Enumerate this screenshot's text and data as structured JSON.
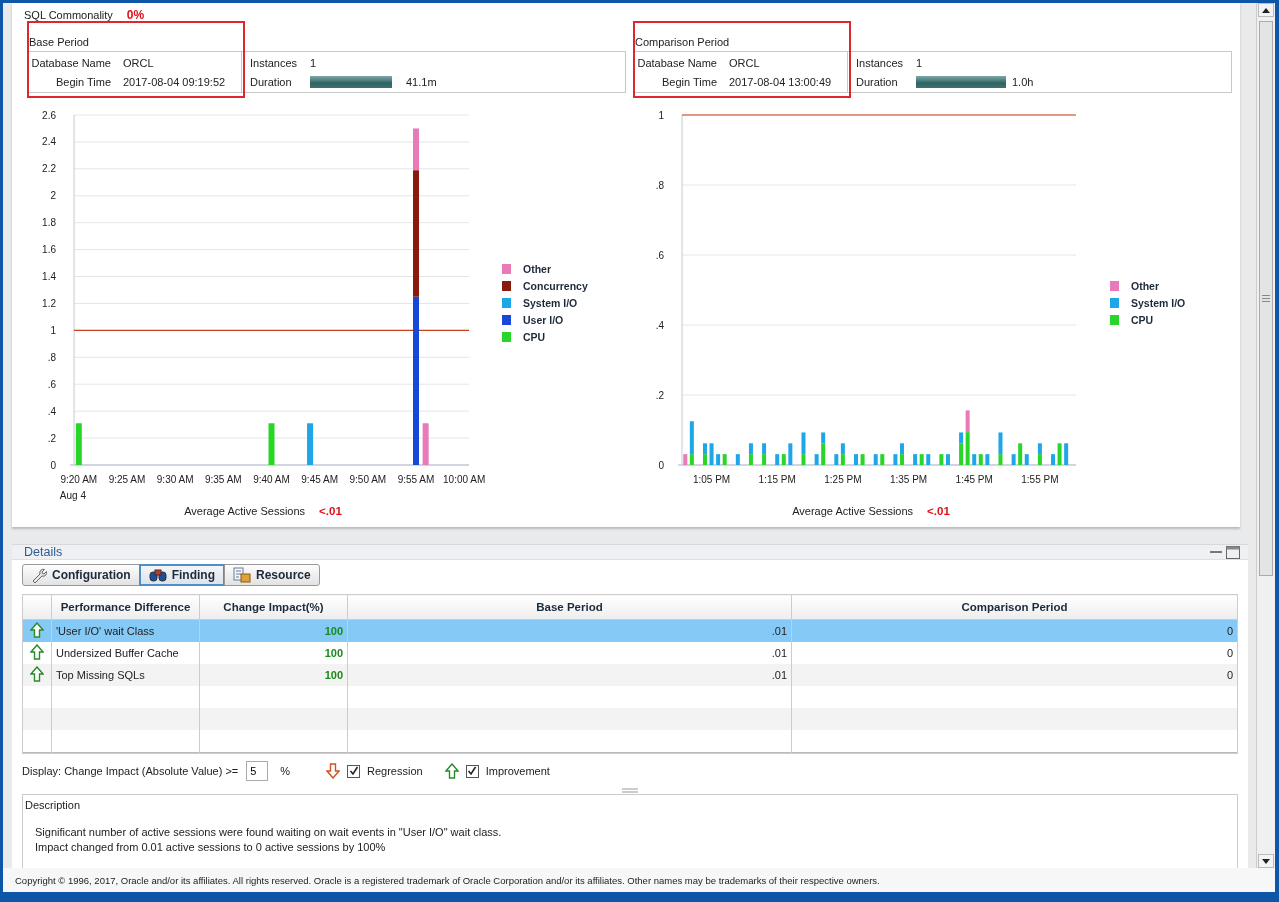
{
  "summary": {
    "label": "SQL Commonality",
    "value": "0%"
  },
  "periods": [
    {
      "title": "Base Period",
      "highlighted": true,
      "database_label": "Database Name",
      "database": "ORCL",
      "begin_label": "Begin Time",
      "begin": "2017-08-04 09:19:52",
      "instances_label": "Instances",
      "instances": "1",
      "duration_label": "Duration",
      "level": 0.91,
      "duration": "41.1m"
    },
    {
      "title": "Comparison Period",
      "highlighted": true,
      "database_label": "Database Name",
      "database": "ORCL",
      "begin_label": "Begin Time",
      "begin": "2017-08-04 13:00:49",
      "instances_label": "Instances",
      "instances": "1",
      "duration_label": "Duration",
      "level": 1.0,
      "duration": "1.0h"
    }
  ],
  "charts": [
    {
      "date_label": "Aug 4",
      "footer_label": "Average Active Sessions",
      "footer_value": "<.01",
      "chart_data": {
        "type": "bar",
        "stacked": true,
        "grid": true,
        "ylim": [
          0,
          2.6
        ],
        "categories": [
          "9:20 AM",
          null,
          null,
          null,
          null,
          "9:25 AM",
          null,
          null,
          null,
          null,
          "9:30 AM",
          null,
          null,
          null,
          null,
          "9:35 AM",
          null,
          null,
          null,
          null,
          "9:40 AM",
          null,
          null,
          null,
          null,
          "9:45 AM",
          null,
          null,
          null,
          null,
          "9:50 AM",
          null,
          null,
          null,
          null,
          "9:55 AM",
          null,
          null,
          null,
          null,
          "10:00 AM"
        ],
        "yticks": [
          0,
          {
            "value": 0.2,
            "label": ".2"
          },
          {
            "value": 0.4,
            "label": ".4"
          },
          {
            "value": 0.6,
            "label": ".6"
          },
          {
            "value": 0.8,
            "label": ".8"
          },
          1,
          1.2,
          1.4,
          1.6,
          1.8,
          2,
          2.2,
          2.4,
          2.6
        ],
        "ref_lines": [
          {
            "axis": "y",
            "value": 1,
            "color": "#c8401e"
          }
        ],
        "series": [
          {
            "name": "Other",
            "color": "#e87ab8",
            "values": [
              null,
              null,
              null,
              null,
              null,
              null,
              null,
              null,
              null,
              null,
              null,
              null,
              null,
              null,
              null,
              null,
              null,
              null,
              null,
              null,
              null,
              null,
              null,
              null,
              null,
              null,
              null,
              null,
              null,
              null,
              null,
              null,
              null,
              null,
              null,
              0.31,
              0.31,
              null,
              null,
              null,
              null
            ]
          },
          {
            "name": "Concurrency",
            "color": "#8b1a0e",
            "values": [
              null,
              null,
              null,
              null,
              null,
              null,
              null,
              null,
              null,
              null,
              null,
              null,
              null,
              null,
              null,
              null,
              null,
              null,
              null,
              null,
              null,
              null,
              null,
              null,
              null,
              null,
              null,
              null,
              null,
              null,
              null,
              null,
              null,
              null,
              null,
              0.94,
              null,
              null,
              null,
              null,
              null
            ]
          },
          {
            "name": "System I/O",
            "color": "#1ea7e8",
            "values": [
              null,
              null,
              null,
              null,
              null,
              null,
              null,
              null,
              null,
              null,
              null,
              null,
              null,
              null,
              null,
              null,
              null,
              null,
              null,
              null,
              null,
              null,
              null,
              null,
              0.31,
              null,
              null,
              null,
              null,
              null,
              null,
              null,
              null,
              null,
              null,
              null,
              null,
              null,
              null,
              null,
              null
            ]
          },
          {
            "name": "User I/O",
            "color": "#1848d8",
            "values": [
              null,
              null,
              null,
              null,
              null,
              null,
              null,
              null,
              null,
              null,
              null,
              null,
              null,
              null,
              null,
              null,
              null,
              null,
              null,
              null,
              null,
              null,
              null,
              null,
              null,
              null,
              null,
              null,
              null,
              null,
              null,
              null,
              null,
              null,
              null,
              1.25,
              null,
              null,
              null,
              null,
              null
            ]
          },
          {
            "name": "CPU",
            "color": "#28d628",
            "values": [
              0.31,
              null,
              null,
              null,
              null,
              null,
              null,
              null,
              null,
              null,
              null,
              null,
              null,
              null,
              null,
              null,
              null,
              null,
              null,
              null,
              0.31,
              null,
              null,
              null,
              null,
              null,
              null,
              null,
              null,
              null,
              null,
              null,
              null,
              null,
              null,
              null,
              null,
              null,
              null,
              null,
              null
            ]
          }
        ]
      }
    },
    {
      "footer_label": "Average Active Sessions",
      "footer_value": "<.01",
      "chart_data": {
        "type": "bar",
        "stacked": true,
        "grid": true,
        "ylim": [
          0,
          1
        ],
        "categories": [
          null,
          null,
          null,
          null,
          "1:05 PM",
          null,
          null,
          null,
          null,
          null,
          null,
          null,
          null,
          null,
          "1:15 PM",
          null,
          null,
          null,
          null,
          null,
          null,
          null,
          null,
          null,
          "1:25 PM",
          null,
          null,
          null,
          null,
          null,
          null,
          null,
          null,
          null,
          "1:35 PM",
          null,
          null,
          null,
          null,
          null,
          null,
          null,
          null,
          null,
          "1:45 PM",
          null,
          null,
          null,
          null,
          null,
          null,
          null,
          null,
          null,
          "1:55 PM",
          null,
          null,
          null,
          null,
          null
        ],
        "yticks": [
          0,
          {
            "value": 0.2,
            "label": ".2"
          },
          {
            "value": 0.4,
            "label": ".4"
          },
          {
            "value": 0.6,
            "label": ".6"
          },
          {
            "value": 0.8,
            "label": ".8"
          },
          1
        ],
        "ref_lines": [
          {
            "axis": "y",
            "value": 1,
            "color": "#c8401e"
          }
        ],
        "series": [
          {
            "name": "Other",
            "color": "#e87ab8",
            "values": [
              0.031,
              null,
              null,
              null,
              null,
              null,
              null,
              null,
              null,
              null,
              null,
              null,
              null,
              null,
              null,
              null,
              null,
              null,
              null,
              null,
              null,
              null,
              null,
              null,
              null,
              null,
              null,
              null,
              null,
              null,
              null,
              null,
              null,
              null,
              null,
              null,
              null,
              null,
              null,
              null,
              null,
              null,
              null,
              0.062,
              null,
              null,
              null,
              null,
              null,
              null,
              null,
              null,
              null,
              null,
              null,
              null,
              null,
              null,
              null,
              null
            ]
          },
          {
            "name": "System I/O",
            "color": "#1ea7e8",
            "values": [
              null,
              0.094,
              null,
              0.031,
              0.062,
              0.031,
              null,
              null,
              0.031,
              null,
              0.031,
              null,
              0.031,
              null,
              0.031,
              null,
              0.062,
              null,
              0.062,
              null,
              0.031,
              0.031,
              null,
              0.031,
              0.031,
              null,
              0.031,
              null,
              null,
              0.031,
              null,
              null,
              0.031,
              0.031,
              null,
              0.031,
              null,
              0.031,
              null,
              null,
              0.031,
              null,
              0.031,
              null,
              0.031,
              null,
              0.031,
              null,
              0.062,
              null,
              0.031,
              null,
              0.031,
              null,
              0.031,
              null,
              0.031,
              null,
              0.062,
              null
            ]
          },
          {
            "name": "CPU",
            "color": "#28d628",
            "values": [
              null,
              0.031,
              null,
              0.031,
              null,
              null,
              0.031,
              null,
              null,
              null,
              0.031,
              null,
              0.031,
              null,
              null,
              0.031,
              null,
              null,
              0.031,
              null,
              null,
              0.062,
              null,
              null,
              0.031,
              null,
              null,
              0.031,
              null,
              null,
              0.031,
              null,
              null,
              0.031,
              null,
              null,
              0.031,
              null,
              null,
              0.031,
              null,
              null,
              0.062,
              0.094,
              null,
              0.031,
              null,
              null,
              0.031,
              null,
              null,
              0.062,
              null,
              null,
              0.031,
              null,
              null,
              0.062,
              null,
              null
            ]
          }
        ]
      }
    }
  ],
  "details": {
    "title": "Details",
    "tabs": [
      {
        "label": "Configuration",
        "kind": "wrench",
        "selected": false
      },
      {
        "label": "Finding",
        "kind": "binoculars",
        "selected": true
      },
      {
        "label": "Resource",
        "kind": "resource",
        "selected": false
      }
    ],
    "table": {
      "columns": [
        "Performance Difference",
        "Change Impact(%)",
        "Base Period",
        "Comparison Period"
      ],
      "rows": [
        {
          "kind": "improvement",
          "selected": true,
          "finding": "'User I/O' wait Class",
          "impact": "100",
          "base": ".01",
          "comparison": "0"
        },
        {
          "kind": "improvement",
          "selected": false,
          "finding": "Undersized Buffer Cache",
          "impact": "100",
          "base": ".01",
          "comparison": "0"
        },
        {
          "kind": "improvement",
          "selected": false,
          "finding": "Top Missing SQLs",
          "impact": "100",
          "base": ".01",
          "comparison": "0"
        }
      ]
    },
    "filter": {
      "label": "Display: Change Impact (Absolute Value) >=",
      "value": "5",
      "unit": "%",
      "options": [
        {
          "kind": "regression",
          "label": "Regression",
          "checked": true
        },
        {
          "kind": "improvement",
          "label": "Improvement",
          "checked": true
        }
      ]
    },
    "description": {
      "title": "Description",
      "lines": [
        "Significant number of active sessions were found waiting on wait events in \"User I/O\" wait class.",
        "Impact changed from 0.01 active sessions to 0 active sessions by 100%"
      ]
    }
  },
  "copyright": "Copyright © 1996, 2017, Oracle and/or its affiliates. All rights reserved. Oracle is a registered trademark of Oracle Corporation and/or its affiliates. Other names may be trademarks of their respective owners."
}
